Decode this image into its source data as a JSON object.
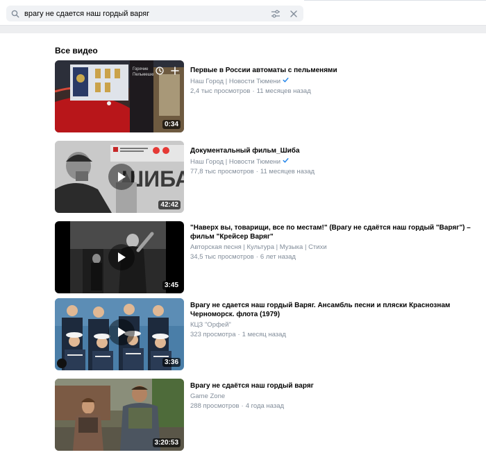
{
  "search": {
    "query": "врагу не сдается наш гордый варяг"
  },
  "section_title": "Все видео",
  "videos": [
    {
      "title": "Первые в России автоматы с пельменями",
      "channel": "Наш Город | Новости Тюмени",
      "verified": true,
      "views": "2,4 тыс просмотров",
      "age": "11 месяцев назад",
      "duration": "0:34"
    },
    {
      "title": "Документальный фильм_Шиба",
      "channel": "Наш Город | Новости Тюмени",
      "verified": true,
      "views": "77,8 тыс просмотров",
      "age": "11 месяцев назад",
      "duration": "42:42"
    },
    {
      "title": "\"Наверх вы, товарищи, все по местам!\" (Врагу не сдаётся наш гордый \"Варяг\") – фильм \"Крейсер Варяг\"",
      "channel": "Авторская песня | Культура | Музыка | Стихи",
      "verified": false,
      "views": "34,5 тыс просмотров",
      "age": "6 лет назад",
      "duration": "3:45"
    },
    {
      "title": "Врагу не сдается наш гордый Варяг. Ансамбль песни и пляски Краснознам Черноморск. флота (1979)",
      "channel": "КЦЗ \"Орфей\"",
      "verified": false,
      "views": "323 просмотра",
      "age": "1 месяц назад",
      "duration": "3:36"
    },
    {
      "title": "Врагу не сдаётся наш гордый варяг",
      "channel": "Game Zone",
      "verified": false,
      "views": "288 просмотров",
      "age": "4 года назад",
      "duration": "3:20:53"
    }
  ],
  "thumb1": {
    "sign_line1": "Горячие",
    "sign_line2": "Пельмешки"
  },
  "thumb2": {
    "banner_text": "ШИБА"
  }
}
